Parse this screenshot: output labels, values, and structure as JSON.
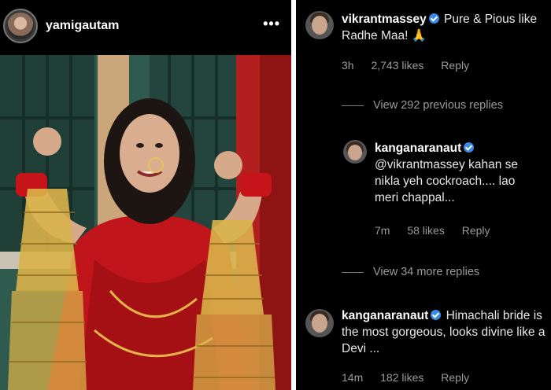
{
  "post": {
    "username": "yamigautam",
    "more_icon": "•••"
  },
  "comments": [
    {
      "user": "vikrantmassey",
      "text": "Pure & Pious like Radhe Maa! 🙏",
      "time": "3h",
      "likes": "2,743 likes",
      "reply": "Reply"
    },
    {
      "user": "kanganaranaut",
      "text": "@vikrantmassey kahan se nikla yeh cockroach.... lao meri chappal...",
      "time": "7m",
      "likes": "58 likes",
      "reply": "Reply"
    },
    {
      "user": "kanganaranaut",
      "text": "Himachali bride is the most gorgeous, looks divine like a Devi ...",
      "time": "14m",
      "likes": "182 likes",
      "reply": "Reply"
    }
  ],
  "view_previous": "View 292 previous replies",
  "view_more": "View 34 more replies",
  "colors": {
    "background": "#000000",
    "verified": "#3a8be8",
    "saree": "#c0161b"
  }
}
